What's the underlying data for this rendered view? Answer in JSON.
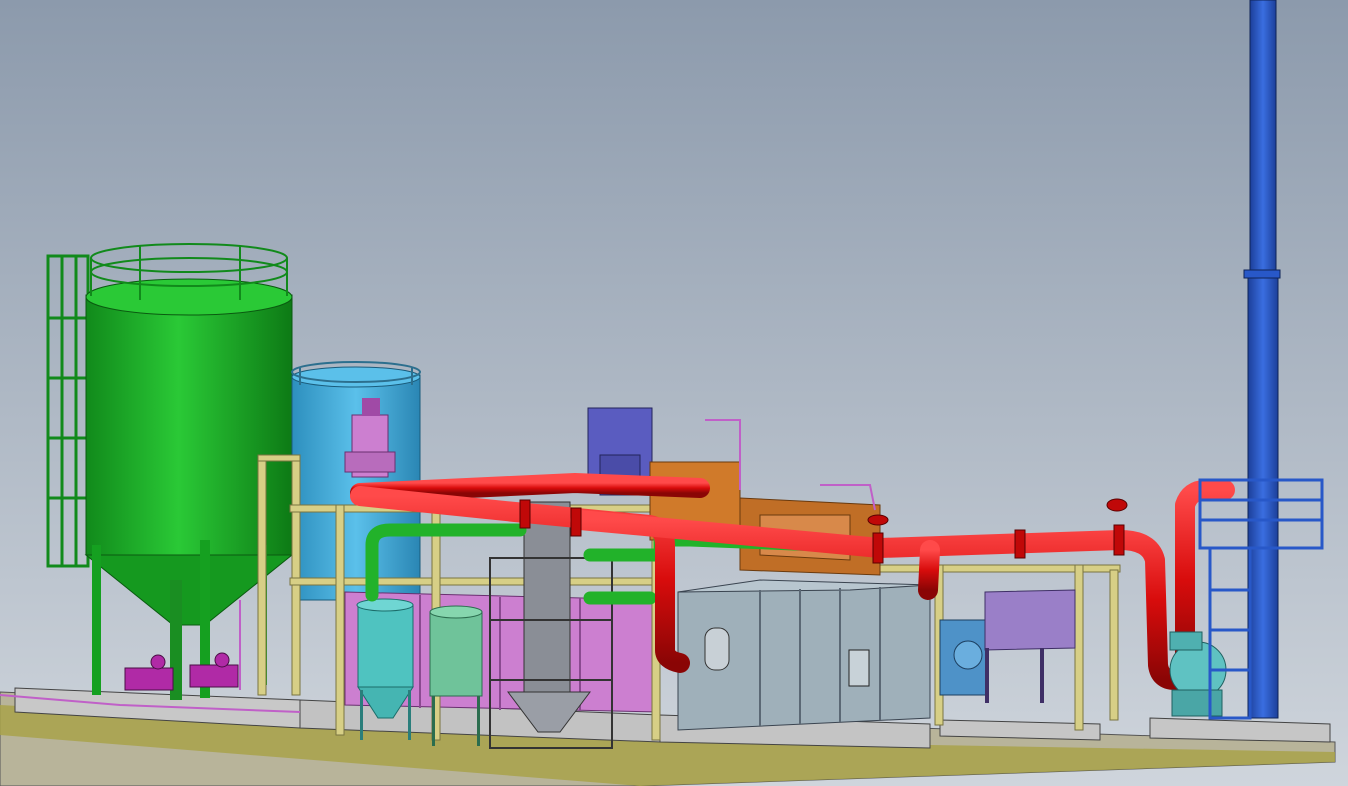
{
  "scene": {
    "colors": {
      "sky_top": "#8c9aac",
      "sky_bottom": "#cfd5dc",
      "ground": "#b8b49a",
      "ground_edge": "#a8a24a",
      "silo": "#1fae2a",
      "silo_dark": "#118a1b",
      "tank_blue": "#3fa9d8",
      "tank_pink": "#cc7fd0",
      "pipe_red": "#e01010",
      "pipe_green": "#22b22a",
      "structure_yellow": "#d7cf86",
      "chimney_blue": "#2858c8",
      "filter_box": "#9fb0ba",
      "fan_teal": "#5fc2c2",
      "purple_box": "#5a5cc0",
      "orange_tank": "#d07a2a",
      "tank_cyan": "#4fc3c0",
      "tank_mint": "#6fc39a",
      "grey_column": "#8a8e96",
      "lilac_box": "#9a7fc8",
      "pump_magenta": "#b02aa6"
    },
    "components": [
      "green-silo",
      "access-ladder-tower",
      "blue-tank",
      "pink-mixer",
      "red-flue-pipe",
      "yellow-pipe-rack",
      "grey-cyclone-column",
      "cyan-tank",
      "mint-tank",
      "pink-bag-filter",
      "purple-hopper",
      "orange-heat-exchanger",
      "filter-house",
      "blue-fan",
      "lilac-box",
      "teal-fan",
      "blue-chimney",
      "chimney-platform",
      "concrete-foundation",
      "magenta-pumps"
    ]
  }
}
